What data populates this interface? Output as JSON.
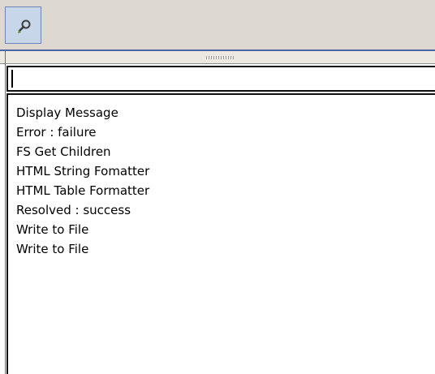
{
  "toolbar": {
    "tool_icon": "inspect-tool-icon"
  },
  "filter": {
    "value": "",
    "placeholder": ""
  },
  "list": {
    "items": [
      {
        "label": "Display Message"
      },
      {
        "label": "Error : failure"
      },
      {
        "label": "FS Get Children"
      },
      {
        "label": "HTML String Fomatter"
      },
      {
        "label": "HTML Table Formatter"
      },
      {
        "label": "Resolved : success"
      },
      {
        "label": "Write to File"
      },
      {
        "label": "Write to File"
      }
    ]
  },
  "colors": {
    "toolbar_bg": "#ddd8d0",
    "button_bg": "#c8d6ea",
    "accent_rule": "#4a66a8"
  }
}
